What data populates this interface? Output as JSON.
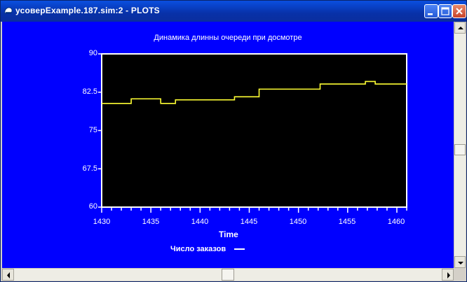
{
  "window": {
    "title": "усоверExample.187.sim:2  -  PLOTS"
  },
  "colors": {
    "background": "#0000ff",
    "plot_background": "#000000",
    "series": "#ffff33",
    "text": "#ffffff"
  },
  "chart_data": {
    "type": "line",
    "title": "Динамика длинны очереди при досмотре",
    "xlabel": "Time",
    "ylabel": "",
    "xlim": [
      1430,
      1461
    ],
    "ylim": [
      60,
      90
    ],
    "x_ticks": [
      "1430",
      "1435",
      "1440",
      "1445",
      "1450",
      "1455",
      "1460"
    ],
    "y_ticks": [
      "90",
      "82.5",
      "75",
      "67.5",
      "60"
    ],
    "step": true,
    "legend": "bottom",
    "series": [
      {
        "name": "Число заказов",
        "x": [
          1430,
          1433,
          1436,
          1437.5,
          1443.5,
          1446,
          1452.2,
          1456.8,
          1457.8,
          1461
        ],
        "y": [
          80.3,
          81.2,
          80.3,
          81,
          81.6,
          83.1,
          84.1,
          84.6,
          84.1,
          84.1
        ]
      }
    ]
  }
}
